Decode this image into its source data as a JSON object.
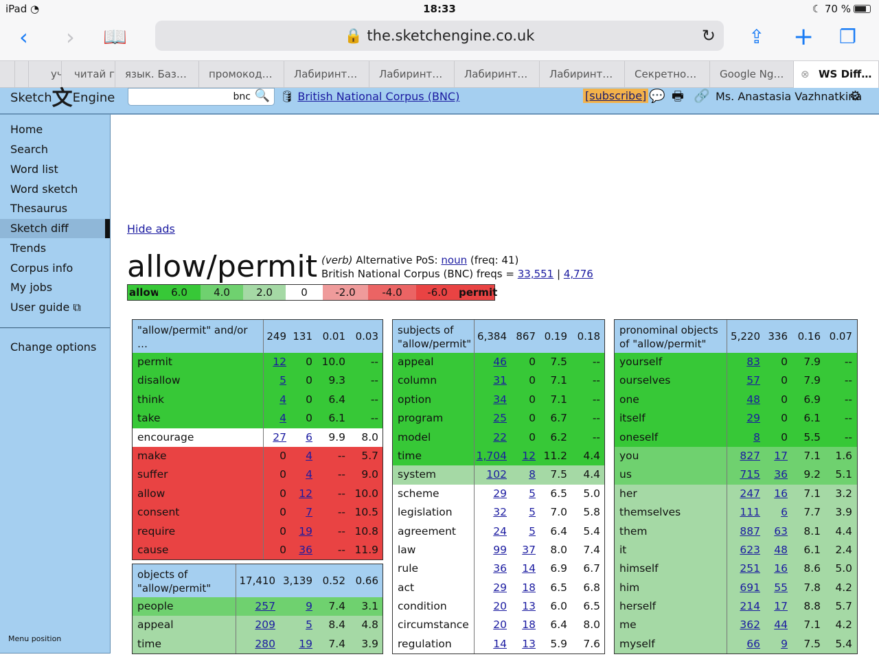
{
  "status": {
    "device": "iPad",
    "time": "18:33",
    "battery": "70 %"
  },
  "browser": {
    "url": "the.sketchengine.co.uk",
    "tabs": [
      "уч",
      "читай го",
      "язык. Баз…",
      "промокод…",
      "Лабиринт…",
      "Лабиринт…",
      "Лабиринт…",
      "Лабиринт…",
      "Секретно…",
      "Google Ng…",
      "WS Diff…"
    ]
  },
  "header": {
    "logo_left": "Sketch",
    "logo_right": "Engine",
    "search_value": "bnc",
    "corpus": "British National Corpus (BNC)",
    "subscribe": "[subscribe]",
    "user": "Ms. Anastasia Vazhnatkina"
  },
  "sidebar": {
    "items": [
      "Home",
      "Search",
      "Word list",
      "Word sketch",
      "Thesaurus",
      "Sketch diff",
      "Trends",
      "Corpus info",
      "My jobs",
      "User guide"
    ],
    "change_options": "Change options",
    "menu_position": "Menu position"
  },
  "main": {
    "hide_ads": "Hide ads",
    "title": "allow/permit",
    "pos": "(verb)",
    "alt_pos_label": "Alternative PoS:",
    "alt_pos_link": "noun",
    "alt_freq": "(freq: 41)",
    "corpus_freqs_label": "British National Corpus (BNC) freqs =",
    "freq1": "33,551",
    "sep": "|",
    "freq2": "4,776"
  },
  "legend": [
    {
      "text": "allow",
      "bg": "#37c837",
      "w": 44,
      "bold": true
    },
    {
      "text": "6.0",
      "bg": "#37c837",
      "w": 62
    },
    {
      "text": "4.0",
      "bg": "#6fd16f",
      "w": 62
    },
    {
      "text": "2.0",
      "bg": "#a5d9a5",
      "w": 62
    },
    {
      "text": "0",
      "bg": "#ffffff",
      "w": 54
    },
    {
      "text": "-2.0",
      "bg": "#ef9b9b",
      "w": 66
    },
    {
      "text": "-4.0",
      "bg": "#eb6464",
      "w": 70
    },
    {
      "text": "-6.0",
      "bg": "#e94343",
      "w": 62
    },
    {
      "text": "permit",
      "bg": "#e94343",
      "w": 52,
      "bold": true
    }
  ],
  "panels": [
    {
      "title": "\"allow/permit\" and/or …",
      "head": [
        "249",
        "131",
        "0.01",
        "0.03"
      ],
      "rows": [
        {
          "w": "permit",
          "c1": "12",
          "c2": "0",
          "s1": "10.0",
          "s2": "--",
          "color": "#37c837",
          "l1": true,
          "l2": false
        },
        {
          "w": "disallow",
          "c1": "5",
          "c2": "0",
          "s1": "9.3",
          "s2": "--",
          "color": "#37c837",
          "l1": true,
          "l2": false
        },
        {
          "w": "think",
          "c1": "4",
          "c2": "0",
          "s1": "6.4",
          "s2": "--",
          "color": "#37c837",
          "l1": true,
          "l2": false
        },
        {
          "w": "take",
          "c1": "4",
          "c2": "0",
          "s1": "6.1",
          "s2": "--",
          "color": "#37c837",
          "l1": true,
          "l2": false
        },
        {
          "w": "encourage",
          "c1": "27",
          "c2": "6",
          "s1": "9.9",
          "s2": "8.0",
          "color": "#ffffff",
          "l1": true,
          "l2": true
        },
        {
          "w": "make",
          "c1": "0",
          "c2": "4",
          "s1": "--",
          "s2": "5.7",
          "color": "#e94343",
          "l1": false,
          "l2": true
        },
        {
          "w": "suffer",
          "c1": "0",
          "c2": "4",
          "s1": "--",
          "s2": "9.0",
          "color": "#e94343",
          "l1": false,
          "l2": true
        },
        {
          "w": "allow",
          "c1": "0",
          "c2": "12",
          "s1": "--",
          "s2": "10.0",
          "color": "#e94343",
          "l1": false,
          "l2": true
        },
        {
          "w": "consent",
          "c1": "0",
          "c2": "7",
          "s1": "--",
          "s2": "10.5",
          "color": "#e94343",
          "l1": false,
          "l2": true
        },
        {
          "w": "require",
          "c1": "0",
          "c2": "19",
          "s1": "--",
          "s2": "10.8",
          "color": "#e94343",
          "l1": false,
          "l2": true
        },
        {
          "w": "cause",
          "c1": "0",
          "c2": "36",
          "s1": "--",
          "s2": "11.9",
          "color": "#e94343",
          "l1": false,
          "l2": true
        }
      ]
    },
    {
      "title": "objects of \"allow/permit\"",
      "head": [
        "17,410",
        "3,139",
        "0.52",
        "0.66"
      ],
      "rows": [
        {
          "w": "people",
          "c1": "257",
          "c2": "9",
          "s1": "7.4",
          "s2": "3.1",
          "color": "#6fd16f",
          "l1": true,
          "l2": true
        },
        {
          "w": "appeal",
          "c1": "209",
          "c2": "5",
          "s1": "8.4",
          "s2": "4.8",
          "color": "#a5d9a5",
          "l1": true,
          "l2": true
        },
        {
          "w": "time",
          "c1": "280",
          "c2": "19",
          "s1": "7.4",
          "s2": "3.9",
          "color": "#a5d9a5",
          "l1": true,
          "l2": true
        }
      ]
    },
    {
      "title": "subjects of \"allow/permit\"",
      "head": [
        "6,384",
        "867",
        "0.19",
        "0.18"
      ],
      "rows": [
        {
          "w": "appeal",
          "c1": "46",
          "c2": "0",
          "s1": "7.5",
          "s2": "--",
          "color": "#37c837",
          "l1": true,
          "l2": false
        },
        {
          "w": "column",
          "c1": "31",
          "c2": "0",
          "s1": "7.1",
          "s2": "--",
          "color": "#37c837",
          "l1": true,
          "l2": false
        },
        {
          "w": "option",
          "c1": "34",
          "c2": "0",
          "s1": "7.1",
          "s2": "--",
          "color": "#37c837",
          "l1": true,
          "l2": false
        },
        {
          "w": "program",
          "c1": "25",
          "c2": "0",
          "s1": "6.7",
          "s2": "--",
          "color": "#37c837",
          "l1": true,
          "l2": false
        },
        {
          "w": "model",
          "c1": "22",
          "c2": "0",
          "s1": "6.2",
          "s2": "--",
          "color": "#37c837",
          "l1": true,
          "l2": false
        },
        {
          "w": "time",
          "c1": "1,704",
          "c2": "12",
          "s1": "11.2",
          "s2": "4.4",
          "color": "#37c837",
          "l1": true,
          "l2": true
        },
        {
          "w": "system",
          "c1": "102",
          "c2": "8",
          "s1": "7.5",
          "s2": "4.4",
          "color": "#a5d9a5",
          "l1": true,
          "l2": true
        },
        {
          "w": "scheme",
          "c1": "29",
          "c2": "5",
          "s1": "6.5",
          "s2": "5.0",
          "color": "#ffffff",
          "l1": true,
          "l2": true
        },
        {
          "w": "legislation",
          "c1": "32",
          "c2": "5",
          "s1": "7.0",
          "s2": "5.8",
          "color": "#ffffff",
          "l1": true,
          "l2": true
        },
        {
          "w": "agreement",
          "c1": "24",
          "c2": "5",
          "s1": "6.4",
          "s2": "5.4",
          "color": "#ffffff",
          "l1": true,
          "l2": true
        },
        {
          "w": "law",
          "c1": "99",
          "c2": "37",
          "s1": "8.0",
          "s2": "7.4",
          "color": "#ffffff",
          "l1": true,
          "l2": true
        },
        {
          "w": "rule",
          "c1": "36",
          "c2": "14",
          "s1": "6.9",
          "s2": "6.7",
          "color": "#ffffff",
          "l1": true,
          "l2": true
        },
        {
          "w": "act",
          "c1": "29",
          "c2": "18",
          "s1": "6.5",
          "s2": "6.8",
          "color": "#ffffff",
          "l1": true,
          "l2": true
        },
        {
          "w": "condition",
          "c1": "20",
          "c2": "13",
          "s1": "6.0",
          "s2": "6.5",
          "color": "#ffffff",
          "l1": true,
          "l2": true
        },
        {
          "w": "circumstance",
          "c1": "20",
          "c2": "18",
          "s1": "6.4",
          "s2": "8.0",
          "color": "#ffffff",
          "l1": true,
          "l2": true
        },
        {
          "w": "regulation",
          "c1": "14",
          "c2": "13",
          "s1": "5.9",
          "s2": "7.6",
          "color": "#ffffff",
          "l1": true,
          "l2": true
        }
      ]
    },
    {
      "title": "pronominal objects of \"allow/permit\"",
      "head": [
        "5,220",
        "336",
        "0.16",
        "0.07"
      ],
      "rows": [
        {
          "w": "yourself",
          "c1": "83",
          "c2": "0",
          "s1": "7.9",
          "s2": "--",
          "color": "#37c837",
          "l1": true,
          "l2": false
        },
        {
          "w": "ourselves",
          "c1": "57",
          "c2": "0",
          "s1": "7.9",
          "s2": "--",
          "color": "#37c837",
          "l1": true,
          "l2": false
        },
        {
          "w": "one",
          "c1": "48",
          "c2": "0",
          "s1": "6.9",
          "s2": "--",
          "color": "#37c837",
          "l1": true,
          "l2": false
        },
        {
          "w": "itself",
          "c1": "29",
          "c2": "0",
          "s1": "6.1",
          "s2": "--",
          "color": "#37c837",
          "l1": true,
          "l2": false
        },
        {
          "w": "oneself",
          "c1": "8",
          "c2": "0",
          "s1": "5.5",
          "s2": "--",
          "color": "#37c837",
          "l1": true,
          "l2": false
        },
        {
          "w": "you",
          "c1": "827",
          "c2": "17",
          "s1": "7.1",
          "s2": "1.6",
          "color": "#6fd16f",
          "l1": true,
          "l2": true
        },
        {
          "w": "us",
          "c1": "715",
          "c2": "36",
          "s1": "9.2",
          "s2": "5.1",
          "color": "#6fd16f",
          "l1": true,
          "l2": true
        },
        {
          "w": "her",
          "c1": "247",
          "c2": "16",
          "s1": "7.1",
          "s2": "3.2",
          "color": "#a5d9a5",
          "l1": true,
          "l2": true
        },
        {
          "w": "themselves",
          "c1": "111",
          "c2": "6",
          "s1": "7.7",
          "s2": "3.9",
          "color": "#a5d9a5",
          "l1": true,
          "l2": true
        },
        {
          "w": "them",
          "c1": "887",
          "c2": "63",
          "s1": "8.1",
          "s2": "4.4",
          "color": "#a5d9a5",
          "l1": true,
          "l2": true
        },
        {
          "w": "it",
          "c1": "623",
          "c2": "48",
          "s1": "6.1",
          "s2": "2.4",
          "color": "#a5d9a5",
          "l1": true,
          "l2": true
        },
        {
          "w": "himself",
          "c1": "251",
          "c2": "16",
          "s1": "8.6",
          "s2": "5.0",
          "color": "#a5d9a5",
          "l1": true,
          "l2": true
        },
        {
          "w": "him",
          "c1": "691",
          "c2": "55",
          "s1": "7.8",
          "s2": "4.2",
          "color": "#a5d9a5",
          "l1": true,
          "l2": true
        },
        {
          "w": "herself",
          "c1": "214",
          "c2": "17",
          "s1": "8.8",
          "s2": "5.7",
          "color": "#a5d9a5",
          "l1": true,
          "l2": true
        },
        {
          "w": "me",
          "c1": "362",
          "c2": "44",
          "s1": "7.1",
          "s2": "4.2",
          "color": "#a5d9a5",
          "l1": true,
          "l2": true
        },
        {
          "w": "myself",
          "c1": "66",
          "c2": "9",
          "s1": "7.5",
          "s2": "5.4",
          "color": "#a5d9a5",
          "l1": true,
          "l2": true
        }
      ]
    }
  ]
}
